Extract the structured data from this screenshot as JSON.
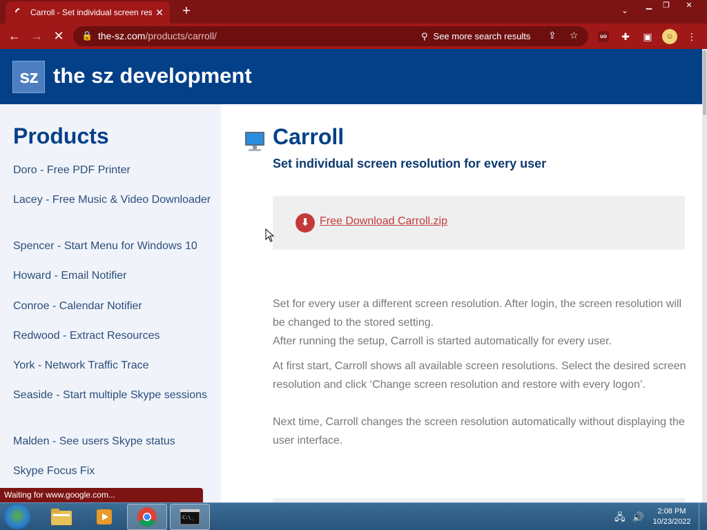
{
  "browser": {
    "tab_title": "Carroll - Set individual screen res",
    "tab_close": "✕",
    "new_tab": "+",
    "url_host": "the-sz.com",
    "url_path": "/products/carroll/",
    "search_chip": "See more search results",
    "status_text": "Waiting for www.google.com..."
  },
  "site": {
    "logo_text": "sz",
    "name": "the sz development"
  },
  "sidebar": {
    "heading": "Products",
    "items": [
      "Doro - Free PDF Printer",
      "Lacey - Free Music & Video Downloader",
      "Spencer - Start Menu for Windows 10",
      "Howard - Email Notifier",
      "Conroe - Calendar Notifier",
      "Redwood - Extract Resources",
      "York - Network Traffic Trace",
      "Seaside - Start multiple Skype sessions",
      "Malden - See users Skype status",
      "Skype Focus Fix"
    ]
  },
  "product": {
    "title": "Carroll",
    "subtitle": "Set individual screen resolution for every user",
    "download_label": "Free Download Carroll.zip",
    "paragraphs": [
      "Set for every user a different screen resolution. After login, the screen resolution will be changed to the stored setting.",
      "After running the setup, Carroll is started automatically for every user.",
      "At first start, Carroll shows all available screen resolutions. Select the desired screen resolution and click ‘Change screen resolution and restore with every logon’.",
      "Next time, Carroll changes the screen resolution automatically without displaying the user interface."
    ]
  },
  "taskbar": {
    "time": "2:08 PM",
    "date": "10/23/2022"
  },
  "colors": {
    "chrome_dark": "#7c1414",
    "chrome": "#a01818",
    "header_blue": "#044088",
    "link_red": "#c43a3a"
  }
}
